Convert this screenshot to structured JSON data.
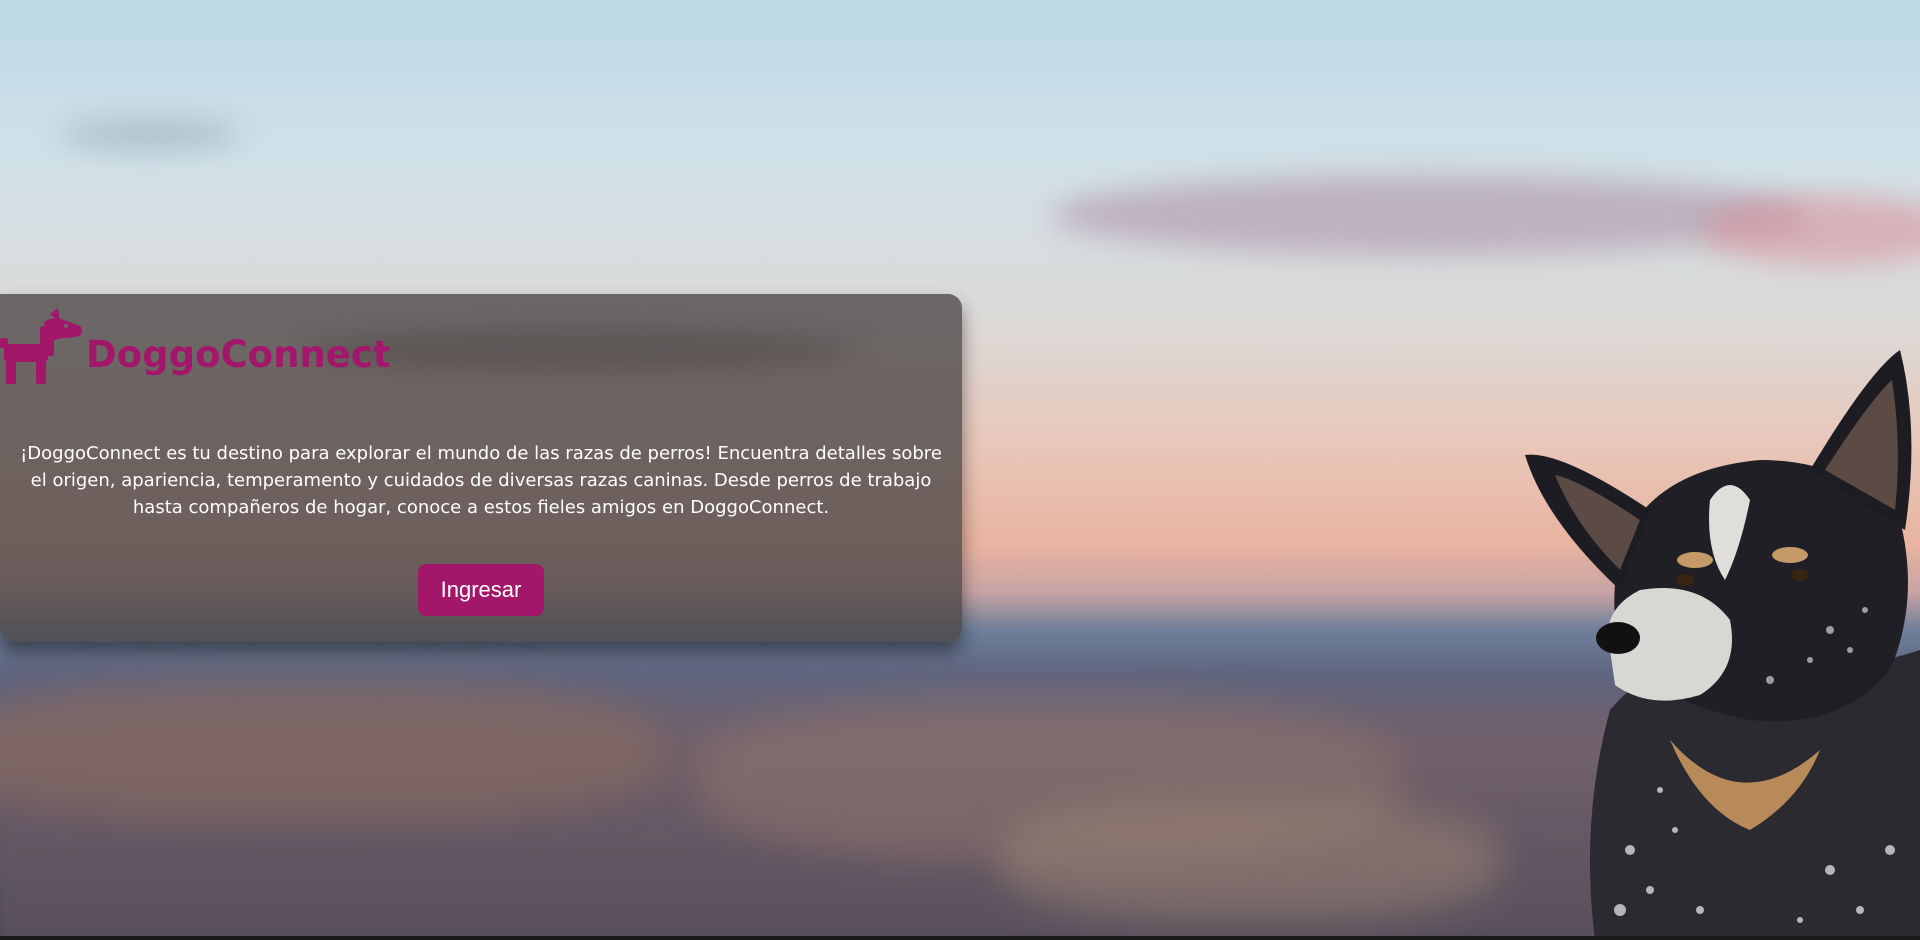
{
  "brand": {
    "name": "DoggoConnect",
    "icon": "dog-icon",
    "color": "#a3176b"
  },
  "hero": {
    "description": "¡DoggoConnect es tu destino para explorar el mundo de las razas de perros! Encuentra detalles sobre el origen, apariencia, temperamento y cuidados de diversas razas caninas. Desde perros de trabajo hasta compañeros de hogar, conoce a estos fieles amigos en DoggoConnect.",
    "button_label": "Ingresar"
  }
}
